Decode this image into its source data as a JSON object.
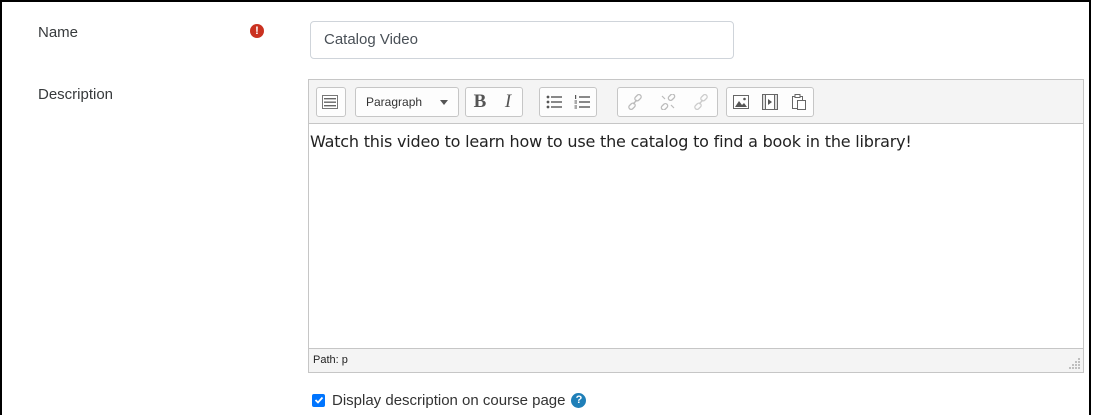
{
  "form": {
    "name_label": "Name",
    "name_value": "Catalog Video",
    "required_icon": "exclamation-circle-icon",
    "description_label": "Description",
    "checkbox_label": "Display description on course page",
    "checkbox_checked": true
  },
  "editor": {
    "format_select": "Paragraph",
    "bold_label": "B",
    "italic_label": "I",
    "content": "Watch this video to learn how to use the catalog to find a book in the library!",
    "path": "Path: p",
    "toolbar_icons": [
      "toolbar-toggle-icon",
      "bold-icon",
      "italic-icon",
      "bullet-list-icon",
      "numbered-list-icon",
      "link-icon",
      "unlink-icon",
      "anchor-icon",
      "image-icon",
      "media-icon",
      "paste-icon"
    ]
  },
  "colors": {
    "required": "#ca3120",
    "checkbox": "#0075ff",
    "help": "#1f7fb8"
  }
}
